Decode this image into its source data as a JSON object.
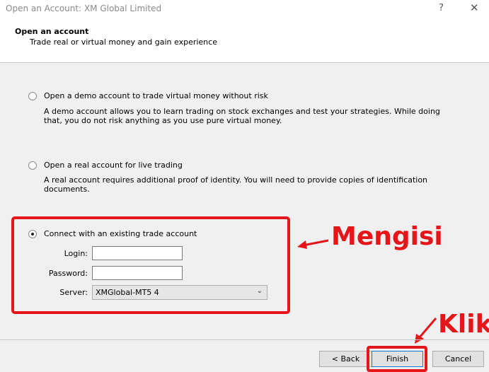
{
  "window": {
    "title": "Open an Account: XM Global Limited",
    "help_glyph": "?",
    "close_glyph": "✕"
  },
  "header": {
    "title": "Open an account",
    "subtitle": "Trade real or virtual money and gain experience"
  },
  "options": [
    {
      "label": "Open a demo account to trade virtual money without risk",
      "description": "A demo account allows you to learn trading on stock exchanges and test your strategies. While doing that, you do not risk anything as you use pure virtual money.",
      "selected": false
    },
    {
      "label": "Open a real account for live trading",
      "description": "A real account requires additional proof of identity. You will need to provide copies of identification documents.",
      "selected": false
    },
    {
      "label": "Connect with an existing trade account",
      "selected": true
    }
  ],
  "form": {
    "login_label": "Login:",
    "login_value": "",
    "password_label": "Password:",
    "password_value": "",
    "server_label": "Server:",
    "server_value": "XMGlobal-MT5 4"
  },
  "annotations": {
    "fill_text": "Mengisi",
    "click_text": "Klik",
    "accent_color": "#e4161a"
  },
  "buttons": {
    "back": "< Back",
    "finish": "Finish",
    "cancel": "Cancel"
  }
}
